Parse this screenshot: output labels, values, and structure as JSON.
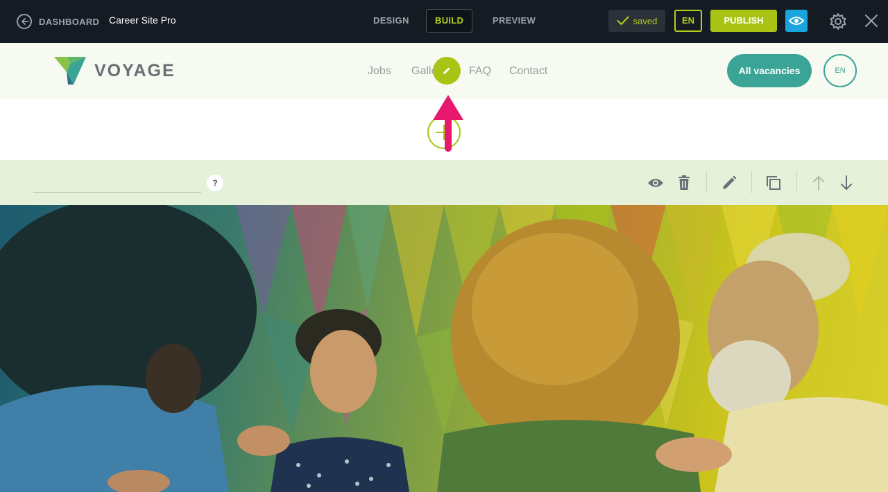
{
  "editor": {
    "back_label": "DASHBOARD",
    "site_name": "Career Site Pro",
    "tabs": [
      {
        "label": "DESIGN",
        "active": false
      },
      {
        "label": "BUILD",
        "active": true
      },
      {
        "label": "PREVIEW",
        "active": false
      }
    ],
    "saved_label": "saved",
    "language": "EN",
    "publish_label": "PUBLISH",
    "icons": [
      "arrow-left-icon",
      "check-icon",
      "eye-icon",
      "gear-icon",
      "close-icon"
    ],
    "colors": {
      "bar": "#151b22",
      "accent": "#a9c414",
      "preview": "#1aa6dd"
    }
  },
  "site": {
    "logo_text": "VOYAGE",
    "nav": [
      "Jobs",
      "Gallery",
      "FAQ",
      "Contact"
    ],
    "vacancies_button": "All vacancies",
    "language": "EN",
    "colors": {
      "primary": "#3aa597",
      "header_bg": "#f7faf1"
    }
  },
  "section_toolbar": {
    "name_value": "",
    "help_label": "?",
    "tools": [
      "eye-icon",
      "trash-icon",
      "pencil-icon",
      "duplicate-icon",
      "arrow-up-icon",
      "arrow-down-icon"
    ]
  },
  "hero": {
    "description": "photo-of-team"
  }
}
